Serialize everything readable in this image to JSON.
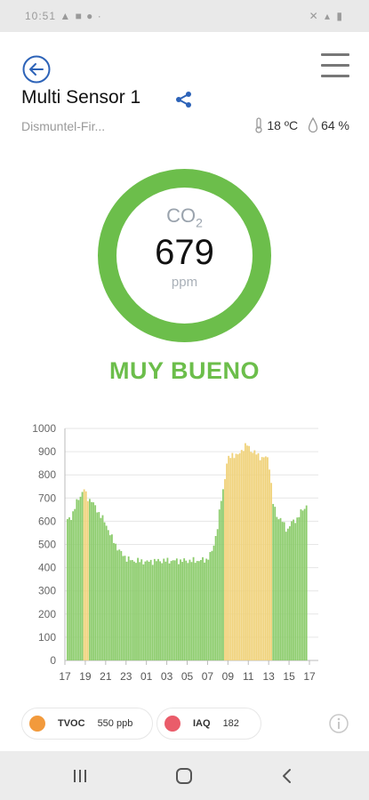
{
  "statusbar": {
    "left": "10:51 ▲ ■ ● ·",
    "right": "✕ ▴ ▮"
  },
  "header": {
    "device_name": "Multi Sensor 1",
    "location": "Dismuntel-Fir..."
  },
  "environment": {
    "temperature": "18 ºC",
    "humidity": "64 %"
  },
  "gauge": {
    "label_main": "CO",
    "label_sub": "2",
    "value": "679",
    "unit": "ppm",
    "ring_color": "#6cbe4b"
  },
  "quality": {
    "text": "MUY BUENO",
    "color": "#6cbe4b"
  },
  "chips": {
    "tvoc": {
      "name": "TVOC",
      "value": "550 ppb",
      "color": "#f29a3c"
    },
    "iaq": {
      "name": "IAQ",
      "value": "182",
      "color": "#ea5c6a"
    }
  },
  "colors": {
    "good": "#8ccc6c",
    "moderate": "#f0d27a"
  },
  "chart_data": {
    "type": "bar",
    "ylim": [
      0,
      1000
    ],
    "yticks": [
      "0",
      "100",
      "200",
      "300",
      "400",
      "500",
      "600",
      "700",
      "800",
      "900",
      "1000"
    ],
    "xticks": [
      "17",
      "19",
      "21",
      "23",
      "01",
      "03",
      "05",
      "07",
      "09",
      "11",
      "13",
      "15",
      "17"
    ],
    "x_range_hours": [
      0,
      24
    ],
    "highlight_periods": [
      [
        1.6,
        2.2
      ],
      [
        15.7,
        20.5
      ]
    ],
    "series": [
      {
        "time": [
          0,
          0.5,
          1,
          1.5,
          1.8,
          2,
          2.5,
          3,
          3.5,
          4,
          4.5,
          5,
          5.5,
          6,
          6.5,
          7,
          8,
          9,
          10,
          11,
          12,
          13,
          14,
          14.5,
          15,
          15.4,
          15.7,
          16,
          16.5,
          17,
          17.5,
          18,
          18.5,
          19,
          19.5,
          20,
          20.3,
          20.5,
          21,
          21.5,
          22,
          22.5,
          23,
          23.5,
          24
        ],
        "values": [
          600,
          620,
          680,
          720,
          745,
          700,
          690,
          650,
          620,
          580,
          530,
          490,
          460,
          440,
          430,
          430,
          425,
          430,
          430,
          430,
          430,
          430,
          435,
          470,
          560,
          690,
          760,
          860,
          890,
          880,
          910,
          930,
          900,
          890,
          870,
          880,
          820,
          690,
          620,
          600,
          560,
          600,
          610,
          650,
          670
        ]
      }
    ]
  }
}
